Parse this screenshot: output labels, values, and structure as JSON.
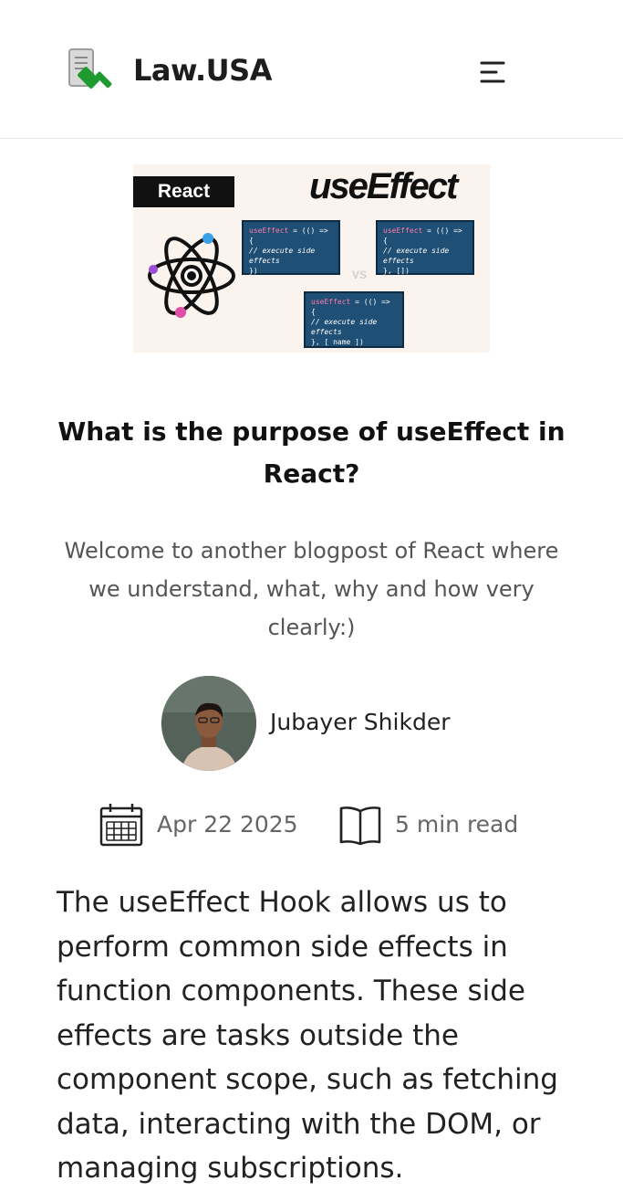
{
  "header": {
    "brand": "Law.USA",
    "logo_icon": "gavel-document-icon",
    "menu_icon": "hamburger-menu-icon"
  },
  "hero_image": {
    "tag": "React",
    "heading": "useEffect",
    "vs": "VS",
    "code_blocks": [
      {
        "line1_kw": "useEffect",
        "line1_rest": " = (() => {",
        "line2": "// execute side effects",
        "line3": "})"
      },
      {
        "line1_kw": "useEffect",
        "line1_rest": " = (() => {",
        "line2": "// execute side effects",
        "line3": "}, [])"
      },
      {
        "line1_kw": "useEffect",
        "line1_rest": " = (() => {",
        "line2": "// execute side effects",
        "line3": "}, [ name ])"
      }
    ],
    "icon": "react-atom-icon"
  },
  "article": {
    "title": "What is the purpose of useEffect in React?",
    "subtitle": "Welcome to another blogpost of React where we understand, what, why and how very clearly:)",
    "author": "Jubayer Shikder",
    "date": "Apr 22 2025",
    "read_time": "5 min read",
    "body": "The useEffect Hook allows us to perform common side effects in function components. These side effects are tasks outside the component scope, such as fetching data, interacting with the DOM, or managing subscriptions."
  },
  "colors": {
    "logo_green": "#1f9a2e",
    "text_dark": "#111111",
    "text_muted": "#555555"
  }
}
